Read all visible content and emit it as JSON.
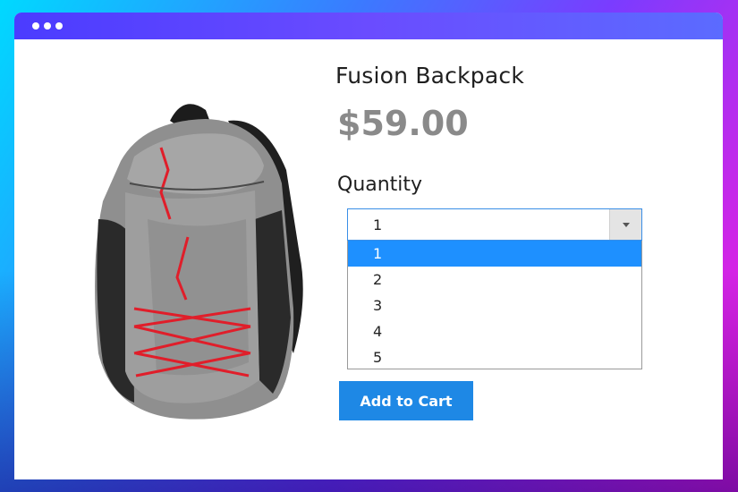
{
  "window": {
    "controls": [
      "dot",
      "dot",
      "dot"
    ]
  },
  "product": {
    "title": "Fusion Backpack",
    "price": "$59.00",
    "image_icon": "backpack-image"
  },
  "quantity": {
    "label": "Quantity",
    "selected": "1",
    "options": [
      "1",
      "2",
      "3",
      "4",
      "5"
    ],
    "highlighted_index": 0
  },
  "cart": {
    "add_label": "Add to Cart"
  },
  "colors": {
    "accent": "#1e88e5",
    "highlight": "#1e90ff",
    "price": "#8a8a8a"
  }
}
